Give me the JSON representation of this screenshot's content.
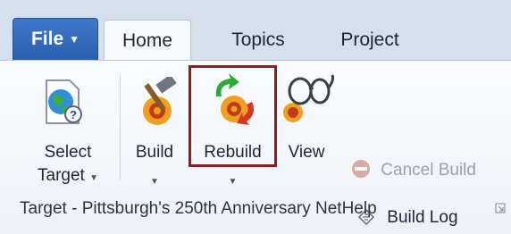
{
  "tabs": {
    "file": "File",
    "items": [
      "Home",
      "Topics",
      "Project"
    ]
  },
  "ribbon": {
    "select_target": {
      "line1": "Select",
      "line2": "Target"
    },
    "build": "Build",
    "rebuild": "Rebuild",
    "view": "View",
    "cancel_build": "Cancel Build",
    "build_log": "Build Log",
    "group_label": "Target - Pittsburgh's 250th Anniversary NetHelp",
    "highlighted": "Rebuild"
  },
  "colors": {
    "file_tab": "#2b5fae",
    "highlight_border": "#8e1d1d",
    "ribbon_bg": "#f4f7fb"
  },
  "icons": [
    "globe-help-icon",
    "hammer-icon",
    "rebuild-icon",
    "glasses-icon",
    "stop-icon",
    "document-icon",
    "dialog-launcher-icon"
  ]
}
